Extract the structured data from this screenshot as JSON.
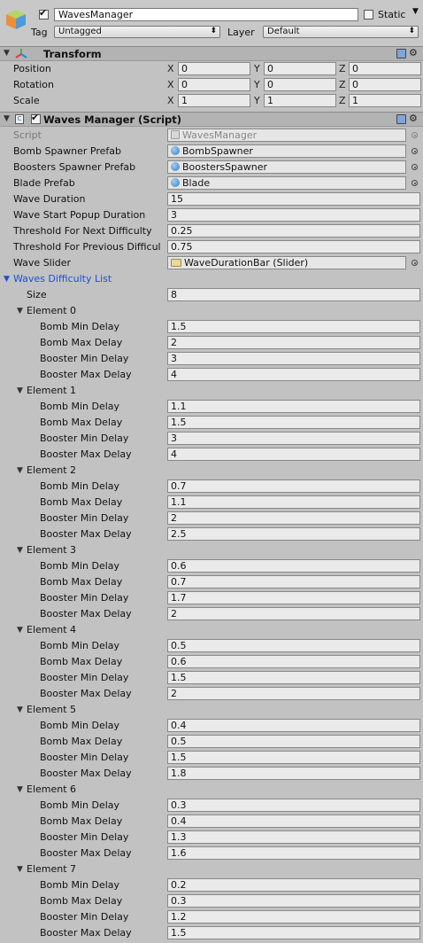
{
  "header": {
    "active": true,
    "name": "WavesManager",
    "static_label": "Static",
    "static_checked": false,
    "tag_label": "Tag",
    "tag_value": "Untagged",
    "layer_label": "Layer",
    "layer_value": "Default"
  },
  "transform": {
    "title": "Transform",
    "rows": [
      {
        "label": "Position",
        "x": "0",
        "y": "0",
        "z": "0"
      },
      {
        "label": "Rotation",
        "x": "0",
        "y": "0",
        "z": "0"
      },
      {
        "label": "Scale",
        "x": "1",
        "y": "1",
        "z": "1"
      }
    ]
  },
  "component": {
    "title": "Waves Manager (Script)",
    "enabled": true,
    "script": {
      "label": "Script",
      "value": "WavesManager"
    },
    "bomb_spawner": {
      "label": "Bomb Spawner Prefab",
      "value": "BombSpawner"
    },
    "boosters_spawner": {
      "label": "Boosters Spawner Prefab",
      "value": "BoostersSpawner"
    },
    "blade": {
      "label": "Blade Prefab",
      "value": "Blade"
    },
    "wave_duration": {
      "label": "Wave Duration",
      "value": "15"
    },
    "popup_duration": {
      "label": "Wave Start Popup Duration",
      "value": "3"
    },
    "threshold_next": {
      "label": "Threshold For Next Difficulty",
      "value": "0.25"
    },
    "threshold_prev": {
      "label": "Threshold For Previous Difficul",
      "value": "0.75"
    },
    "wave_slider": {
      "label": "Wave Slider",
      "value": "WaveDurationBar (Slider)"
    },
    "list_label": "Waves Difficulty List",
    "size_label": "Size",
    "size_value": "8",
    "field_labels": [
      "Bomb Min Delay",
      "Bomb Max Delay",
      "Booster Min Delay",
      "Booster Max Delay"
    ],
    "elements": [
      {
        "label": "Element 0",
        "values": [
          "1.5",
          "2",
          "3",
          "4"
        ]
      },
      {
        "label": "Element 1",
        "values": [
          "1.1",
          "1.5",
          "3",
          "4"
        ]
      },
      {
        "label": "Element 2",
        "values": [
          "0.7",
          "1.1",
          "2",
          "2.5"
        ]
      },
      {
        "label": "Element 3",
        "values": [
          "0.6",
          "0.7",
          "1.7",
          "2"
        ]
      },
      {
        "label": "Element 4",
        "values": [
          "0.5",
          "0.6",
          "1.5",
          "2"
        ]
      },
      {
        "label": "Element 5",
        "values": [
          "0.4",
          "0.5",
          "1.5",
          "1.8"
        ]
      },
      {
        "label": "Element 6",
        "values": [
          "0.3",
          "0.4",
          "1.3",
          "1.6"
        ]
      },
      {
        "label": "Element 7",
        "values": [
          "0.2",
          "0.3",
          "1.2",
          "1.5"
        ]
      }
    ]
  },
  "icons": {
    "gameobject": "cube-icon",
    "transform": "axes-icon",
    "script": "script-icon",
    "help": "help-book-icon",
    "settings": "gear-icon",
    "object_picker": "object-picker-icon"
  },
  "colors": {
    "background": "#c2c2c2",
    "section_header": "#b3b3b3",
    "list_label": "#1a4fd6"
  }
}
